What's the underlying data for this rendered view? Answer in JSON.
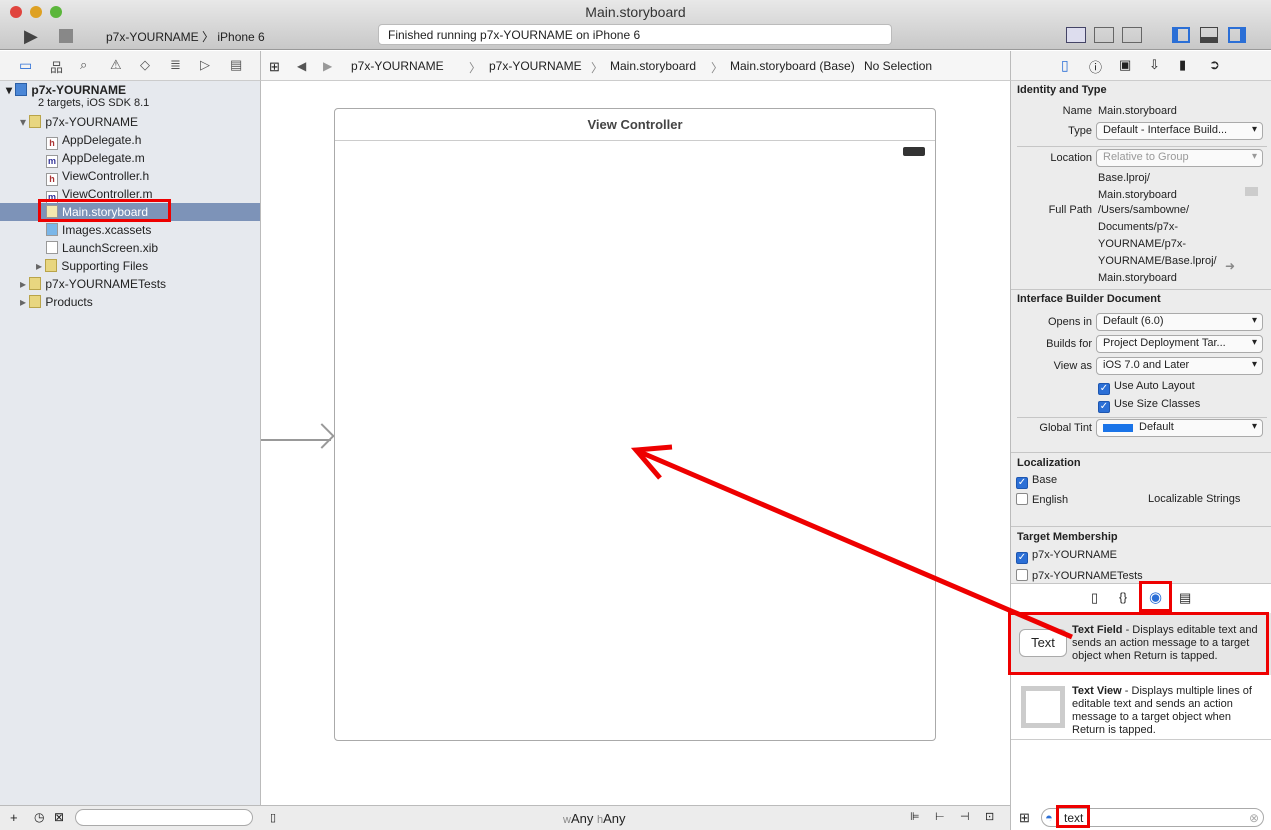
{
  "window": {
    "title": "Main.storyboard",
    "status": "Finished running p7x-YOURNAME on iPhone 6",
    "scheme": "p7x-YOURNAME",
    "device": "iPhone 6"
  },
  "jumpbar": {
    "items": [
      "p7x-YOURNAME",
      "p7x-YOURNAME",
      "Main.storyboard",
      "Main.storyboard (Base)",
      "No Selection"
    ]
  },
  "navigator": {
    "project": "p7x-YOURNAME",
    "project_sub": "2 targets, iOS SDK 8.1",
    "items": [
      {
        "label": "p7x-YOURNAME",
        "icon": "folder",
        "level": 1
      },
      {
        "label": "AppDelegate.h",
        "icon": "h",
        "level": 2
      },
      {
        "label": "AppDelegate.m",
        "icon": "m",
        "level": 2
      },
      {
        "label": "ViewController.h",
        "icon": "h",
        "level": 2
      },
      {
        "label": "ViewController.m",
        "icon": "m",
        "level": 2
      },
      {
        "label": "Main.storyboard",
        "icon": "storyboard",
        "level": 2,
        "selected": true
      },
      {
        "label": "Images.xcassets",
        "icon": "assets",
        "level": 2
      },
      {
        "label": "LaunchScreen.xib",
        "icon": "xib",
        "level": 2
      },
      {
        "label": "Supporting Files",
        "icon": "folder",
        "level": 2
      },
      {
        "label": "p7x-YOURNAMETests",
        "icon": "folder",
        "level": 1
      },
      {
        "label": "Products",
        "icon": "folder",
        "level": 1
      }
    ]
  },
  "canvas": {
    "scene_title": "View Controller",
    "size_class_w": "w",
    "size_class_any1": "Any",
    "size_class_h": "h",
    "size_class_any2": "Any"
  },
  "inspector": {
    "identity_title": "Identity and Type",
    "name_label": "Name",
    "name_value": "Main.storyboard",
    "type_label": "Type",
    "type_value": "Default - Interface Build...",
    "location_label": "Location",
    "location_value": "Relative to Group",
    "rel_path": "Base.lproj/\nMain.storyboard",
    "full_path_label": "Full Path",
    "full_path": "/Users/sambowne/\nDocuments/p7x-\nYOURNAME/p7x-\nYOURNAME/Base.lproj/\nMain.storyboard",
    "ib_title": "Interface Builder Document",
    "opens_in_label": "Opens in",
    "opens_in": "Default (6.0)",
    "builds_for_label": "Builds for",
    "builds_for": "Project Deployment Tar...",
    "view_as_label": "View as",
    "view_as": "iOS 7.0 and Later",
    "auto_layout": "Use Auto Layout",
    "size_classes": "Use Size Classes",
    "tint_label": "Global Tint",
    "tint_value": "Default",
    "tint_color": "#1a74e8",
    "loc_title": "Localization",
    "loc_base": "Base",
    "loc_english": "English",
    "loc_english_type": "Localizable Strings",
    "target_title": "Target Membership",
    "target1": "p7x-YOURNAME",
    "target2": "p7x-YOURNAMETests"
  },
  "library": {
    "items": [
      {
        "icon_text": "Text",
        "title": "Text Field",
        "desc": " - Displays editable text and sends an action message to a target object when Return is tapped."
      },
      {
        "title": "Text View",
        "desc": " - Displays multiple lines of editable text and sends an action message to a target object when Return is tapped."
      }
    ],
    "filter": "text"
  }
}
